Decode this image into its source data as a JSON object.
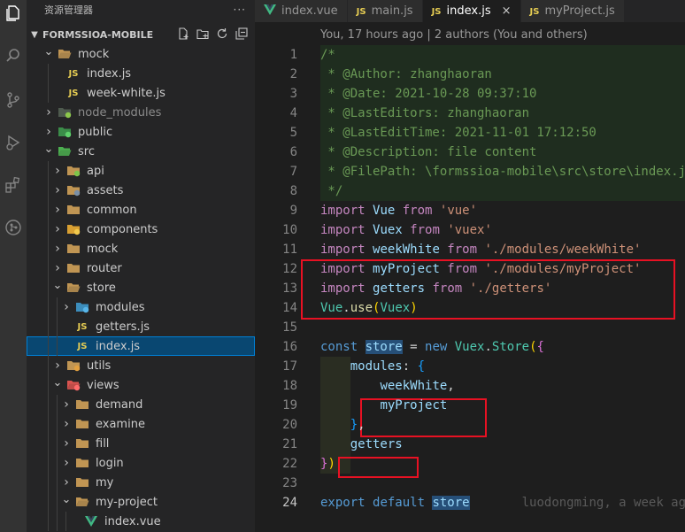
{
  "activity": {
    "icons": [
      "files-icon",
      "search-icon",
      "source-control-icon",
      "run-debug-icon",
      "extensions-icon",
      "gitlens-icon"
    ]
  },
  "sidebar": {
    "header": "资源管理器",
    "more": "···",
    "project": "FORMSSIOA-MOBILE",
    "tree": [
      {
        "label": "mock",
        "depth": 1,
        "kind": "folder-open",
        "chev": "open",
        "color": "#c09553"
      },
      {
        "label": "index.js",
        "depth": 2,
        "kind": "js",
        "chev": ""
      },
      {
        "label": "week-white.js",
        "depth": 2,
        "kind": "js",
        "chev": ""
      },
      {
        "label": "node_modules",
        "depth": 1,
        "kind": "folder-node",
        "chev": "closed",
        "dim": true
      },
      {
        "label": "public",
        "depth": 1,
        "kind": "folder-public",
        "chev": "closed"
      },
      {
        "label": "src",
        "depth": 1,
        "kind": "folder-src",
        "chev": "open"
      },
      {
        "label": "api",
        "depth": 2,
        "kind": "folder-api",
        "chev": "closed"
      },
      {
        "label": "assets",
        "depth": 2,
        "kind": "folder-assets",
        "chev": "closed"
      },
      {
        "label": "common",
        "depth": 2,
        "kind": "folder",
        "chev": "closed"
      },
      {
        "label": "components",
        "depth": 2,
        "kind": "folder-components",
        "chev": "closed"
      },
      {
        "label": "mock",
        "depth": 2,
        "kind": "folder",
        "chev": "closed"
      },
      {
        "label": "router",
        "depth": 2,
        "kind": "folder",
        "chev": "closed"
      },
      {
        "label": "store",
        "depth": 2,
        "kind": "folder-open",
        "chev": "open"
      },
      {
        "label": "modules",
        "depth": 3,
        "kind": "folder-modules",
        "chev": "closed"
      },
      {
        "label": "getters.js",
        "depth": 3,
        "kind": "js",
        "chev": ""
      },
      {
        "label": "index.js",
        "depth": 3,
        "kind": "js",
        "chev": "",
        "selected": true
      },
      {
        "label": "utils",
        "depth": 2,
        "kind": "folder-utils",
        "chev": "closed"
      },
      {
        "label": "views",
        "depth": 2,
        "kind": "folder-views",
        "chev": "open"
      },
      {
        "label": "demand",
        "depth": 3,
        "kind": "folder",
        "chev": "closed"
      },
      {
        "label": "examine",
        "depth": 3,
        "kind": "folder",
        "chev": "closed"
      },
      {
        "label": "fill",
        "depth": 3,
        "kind": "folder",
        "chev": "closed"
      },
      {
        "label": "login",
        "depth": 3,
        "kind": "folder",
        "chev": "closed"
      },
      {
        "label": "my",
        "depth": 3,
        "kind": "folder",
        "chev": "closed"
      },
      {
        "label": "my-project",
        "depth": 3,
        "kind": "folder-open",
        "chev": "open"
      },
      {
        "label": "index.vue",
        "depth": 4,
        "kind": "vue",
        "chev": ""
      }
    ]
  },
  "tabs": [
    {
      "label": "index.vue",
      "icon": "vue",
      "active": false
    },
    {
      "label": "main.js",
      "icon": "js",
      "active": false
    },
    {
      "label": "index.js",
      "icon": "js",
      "active": true,
      "close": "×"
    },
    {
      "label": "myProject.js",
      "icon": "js",
      "active": false
    }
  ],
  "editor": {
    "blame": "You, 17 hours ago | 2 authors (You and others)",
    "current_line": 24,
    "line_numbers": [
      "1",
      "2",
      "3",
      "4",
      "5",
      "6",
      "7",
      "8",
      "9",
      "10",
      "11",
      "12",
      "13",
      "14",
      "15",
      "16",
      "17",
      "18",
      "19",
      "20",
      "21",
      "22",
      "23",
      "24"
    ],
    "lines": [
      [
        [
          "cm",
          "/*"
        ]
      ],
      [
        [
          "cm",
          " * @Author: zhanghaoran"
        ]
      ],
      [
        [
          "cm",
          " * @Date: 2021-10-28 09:37:10"
        ]
      ],
      [
        [
          "cm",
          " * @LastEditors: zhanghaoran"
        ]
      ],
      [
        [
          "cm",
          " * @LastEditTime: 2021-11-01 17:12:50"
        ]
      ],
      [
        [
          "cm",
          " * @Description: file content"
        ]
      ],
      [
        [
          "cm",
          " * @FilePath: \\formssioa-mobile\\src\\store\\index.js"
        ]
      ],
      [
        [
          "cm",
          " */"
        ]
      ],
      [
        [
          "kw2",
          "import "
        ],
        [
          "id",
          "Vue"
        ],
        [
          "kw2",
          " from "
        ],
        [
          "str",
          "'vue'"
        ]
      ],
      [
        [
          "kw2",
          "import "
        ],
        [
          "id",
          "Vuex"
        ],
        [
          "kw2",
          " from "
        ],
        [
          "str",
          "'vuex'"
        ]
      ],
      [
        [
          "kw2",
          "import "
        ],
        [
          "id",
          "weekWhite"
        ],
        [
          "kw2",
          " from "
        ],
        [
          "str",
          "'./modules/weekWhite'"
        ]
      ],
      [
        [
          "kw2",
          "import "
        ],
        [
          "id",
          "myProject"
        ],
        [
          "kw2",
          " from "
        ],
        [
          "str",
          "'./modules/myProject'"
        ]
      ],
      [
        [
          "kw2",
          "import "
        ],
        [
          "id",
          "getters"
        ],
        [
          "kw2",
          " from "
        ],
        [
          "str",
          "'./getters'"
        ]
      ],
      [
        [
          "ty",
          "Vue"
        ],
        [
          "",
          "."
        ],
        [
          "fn",
          "use"
        ],
        [
          "br1",
          "("
        ],
        [
          "ty",
          "Vuex"
        ],
        [
          "br1",
          ")"
        ]
      ],
      [],
      [
        [
          "kw",
          "const "
        ],
        [
          "hlid",
          "store"
        ],
        [
          "",
          " = "
        ],
        [
          "kw",
          "new "
        ],
        [
          "ty",
          "Vuex"
        ],
        [
          "",
          "."
        ],
        [
          "ty",
          "Store"
        ],
        [
          "br1",
          "("
        ],
        [
          "br2",
          "{"
        ]
      ],
      [
        [
          "",
          "    "
        ],
        [
          "id",
          "modules"
        ],
        [
          "",
          ": "
        ],
        [
          "br3",
          "{"
        ]
      ],
      [
        [
          "",
          "        "
        ],
        [
          "id",
          "weekWhite"
        ],
        [
          "",
          ","
        ]
      ],
      [
        [
          "",
          "        "
        ],
        [
          "id",
          "myProject"
        ]
      ],
      [
        [
          "",
          "    "
        ],
        [
          "br3",
          "}"
        ],
        [
          "",
          ","
        ]
      ],
      [
        [
          "",
          "    "
        ],
        [
          "id",
          "getters"
        ]
      ],
      [
        [
          "br2",
          "}"
        ],
        [
          "br1",
          ")"
        ]
      ],
      [],
      [
        [
          "kw",
          "export "
        ],
        [
          "kw",
          "default "
        ],
        [
          "hlid",
          "store"
        ],
        [
          "ghost",
          "       luodongming, a week ago"
        ]
      ]
    ]
  }
}
